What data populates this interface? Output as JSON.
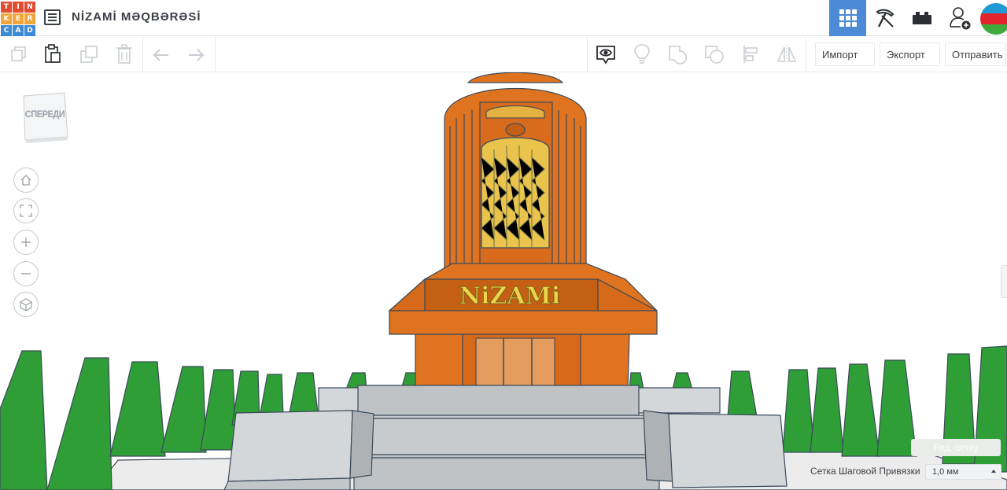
{
  "header": {
    "logo_letters": [
      "T",
      "I",
      "N",
      "K",
      "E",
      "R",
      "C",
      "A",
      "D"
    ],
    "logo_colors": [
      "#e14d32",
      "#e14d32",
      "#e14d32",
      "#f0a53a",
      "#f0a53a",
      "#f0a53a",
      "#3c8ad6",
      "#3c8ad6",
      "#3c8ad6"
    ],
    "design_title": "NİZAMİ MƏQBƏRƏSİ",
    "views": [
      {
        "name": "3d-design-view",
        "icon": "grid-icon",
        "active": true
      },
      {
        "name": "codeblocks-view",
        "icon": "pickaxe-icon",
        "active": false
      },
      {
        "name": "bricks-view",
        "icon": "brick-icon",
        "active": false
      }
    ],
    "invite_icon": "add-user-icon",
    "avatar": "azerbaijan-flag-avatar",
    "flag_colors": [
      "#1f9ad6",
      "#e4232e",
      "#3faa3b"
    ]
  },
  "toolbar": {
    "tools_left": [
      "copy-icon",
      "paste-icon",
      "duplicate-icon",
      "delete-icon",
      "undo-icon",
      "redo-icon"
    ],
    "tools_right": [
      "show-hide-icon",
      "lightbulb-icon",
      "group-icon",
      "ungroup-icon",
      "align-icon",
      "mirror-icon"
    ],
    "import_label": "Импорт",
    "export_label": "Экспорт",
    "send_label": "Отправить"
  },
  "viewport": {
    "viewcube_label": "СПЕРЕДИ",
    "nav_buttons": [
      "home-view-icon",
      "fit-view-icon",
      "zoom-in-icon",
      "zoom-out-icon",
      "ortho-view-icon"
    ],
    "model_text": "NiZAMi",
    "grid_edit_label": "Ред. сетку",
    "snap_label": "Сетка Шаговой Привязки",
    "snap_value": "1,0 мм"
  },
  "colors": {
    "accent": "#4c8ad6",
    "model_orange": "#e0731f",
    "model_orange_dark": "#c55f14",
    "stone": "#aeb2b5",
    "tree_green": "#2f9e36",
    "glass": "#e9c34b",
    "text": "#3b3f45"
  }
}
